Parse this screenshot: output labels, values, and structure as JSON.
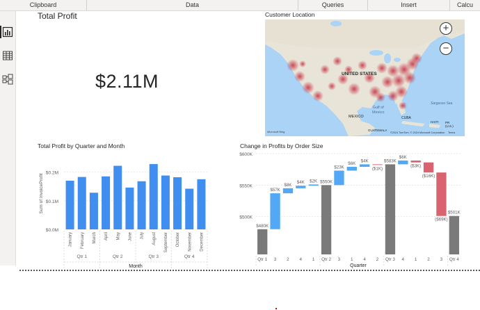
{
  "ribbon": {
    "groups": [
      "Clipboard",
      "Data",
      "Queries",
      "Insert",
      "Calcu"
    ]
  },
  "leftbar": {
    "items": [
      {
        "icon": "report-view-icon"
      },
      {
        "icon": "table-view-icon"
      },
      {
        "icon": "model-view-icon"
      }
    ]
  },
  "kpi": {
    "title": "Total Profit",
    "value": "$2.11M"
  },
  "map": {
    "title": "Customer Location",
    "labels": {
      "country": "UNITED STATES",
      "gulf": "Gulf of\nMexico",
      "mexico": "MEXICO",
      "cuba": "CUBA",
      "haiti": "HAITI",
      "pr": "PR\n(U.S.)",
      "guatemala": "GUATEMALA",
      "sea": "Sargasso Sea",
      "attribution": "©2024 TomTom, © 2024 Microsoft Corporation",
      "terms": "Terms",
      "bing": "Microsoft Bing"
    },
    "zoom_in": "+",
    "zoom_out": "−"
  },
  "chart_data": [
    {
      "type": "bar",
      "title": "Total Profit by Quarter and Month",
      "xlabel": "Month",
      "ylabel": "Sum of InvoiceProfit",
      "ylim": [
        0,
        0.25
      ],
      "yticks": [
        "$0.0M",
        "$0.1M",
        "$0.2M"
      ],
      "ytick_values": [
        0,
        0.1,
        0.2
      ],
      "categories": [
        "January",
        "February",
        "March",
        "April",
        "May",
        "June",
        "July",
        "August",
        "September",
        "October",
        "November",
        "December"
      ],
      "groups": [
        "Qtr 1",
        "Qtr 2",
        "Qtr 3",
        "Qtr 4"
      ],
      "values": [
        0.17,
        0.183,
        0.128,
        0.185,
        0.222,
        0.146,
        0.168,
        0.228,
        0.188,
        0.182,
        0.142,
        0.175
      ],
      "color": "#3f8ef0"
    },
    {
      "type": "waterfall",
      "title": "Change in Profits by Order Size",
      "xlabel": "Quarter",
      "ylabel": "",
      "ylim": [
        440,
        600
      ],
      "yticks": [
        "$500K",
        "$550K",
        "$600K"
      ],
      "ytick_values": [
        500,
        550,
        600
      ],
      "bars": [
        {
          "x": "Qtr 1",
          "kind": "total",
          "start": 0,
          "end": 480,
          "label": "$480K"
        },
        {
          "x": "3",
          "kind": "up",
          "start": 480,
          "end": 537,
          "label": "$57K"
        },
        {
          "x": "2",
          "kind": "up",
          "start": 537,
          "end": 545,
          "label": "$8K"
        },
        {
          "x": "4",
          "kind": "up",
          "start": 545,
          "end": 549,
          "label": "$4K"
        },
        {
          "x": "1",
          "kind": "up",
          "start": 549,
          "end": 551,
          "label": "$2K"
        },
        {
          "x": "Qtr 2",
          "kind": "total",
          "start": 0,
          "end": 550,
          "label": "$550K"
        },
        {
          "x": "3",
          "kind": "up",
          "start": 550,
          "end": 573,
          "label": "$23K"
        },
        {
          "x": "1",
          "kind": "up",
          "start": 573,
          "end": 579,
          "label": "$6K"
        },
        {
          "x": "4",
          "kind": "up",
          "start": 579,
          "end": 583,
          "label": "$4K"
        },
        {
          "x": "2",
          "kind": "down",
          "start": 583,
          "end": 582,
          "label": "($1K)"
        },
        {
          "x": "Qtr 3",
          "kind": "total",
          "start": 0,
          "end": 583,
          "label": "$583K"
        },
        {
          "x": "4",
          "kind": "up",
          "start": 583,
          "end": 589,
          "label": "$6K"
        },
        {
          "x": "1",
          "kind": "down",
          "start": 589,
          "end": 586,
          "label": "($3K)"
        },
        {
          "x": "2",
          "kind": "down",
          "start": 586,
          "end": 570,
          "label": "($16K)"
        },
        {
          "x": "3",
          "kind": "down",
          "start": 570,
          "end": 501,
          "label": "($69K)"
        },
        {
          "x": "Qtr 4",
          "kind": "total",
          "start": 0,
          "end": 501,
          "label": "$501K"
        }
      ],
      "colors": {
        "total": "#7a7a7a",
        "up": "#52a8f5",
        "down": "#d9646f"
      }
    }
  ]
}
